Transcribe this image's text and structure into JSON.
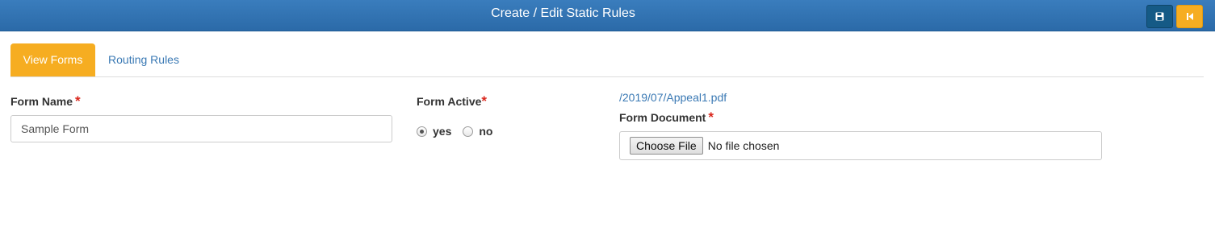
{
  "header": {
    "title": "Create / Edit Static Rules",
    "save_icon": "floppy-disk-icon",
    "back_icon": "skip-back-icon",
    "colors": {
      "bar": "#2f72b3",
      "save_button": "#155a86",
      "back_button": "#f6ad21"
    }
  },
  "tabs": [
    {
      "label": "View Forms",
      "active": true
    },
    {
      "label": "Routing Rules",
      "active": false
    }
  ],
  "form": {
    "form_name": {
      "label": "Form Name",
      "required_marker": "*",
      "value": "Sample Form"
    },
    "form_active": {
      "label": "Form Active",
      "required_marker": "*",
      "options": [
        {
          "label": "yes",
          "checked": true
        },
        {
          "label": "no",
          "checked": false
        }
      ]
    },
    "form_document": {
      "current_file": "/2019/07/Appeal1.pdf",
      "label": "Form Document",
      "required_marker": "*",
      "button_label": "Choose File",
      "status": "No file chosen"
    }
  }
}
